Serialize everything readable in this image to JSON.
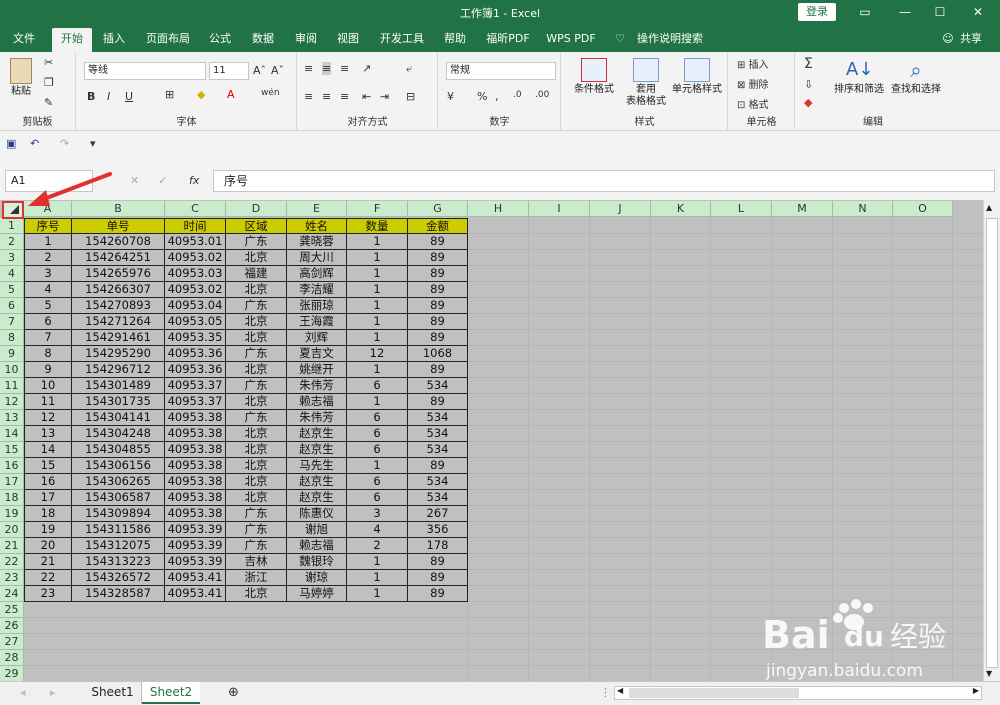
{
  "window": {
    "title": "工作簿1 - Excel",
    "login_label": "登录",
    "share_label": "共享"
  },
  "menu_tabs": [
    "文件",
    "开始",
    "插入",
    "页面布局",
    "公式",
    "数据",
    "审阅",
    "视图",
    "开发工具",
    "帮助",
    "福昕PDF",
    "WPS PDF",
    "操作说明搜索"
  ],
  "ribbon": {
    "clipboard": {
      "label": "剪贴板",
      "paste": "粘贴"
    },
    "font": {
      "label": "字体",
      "name": "等线",
      "size": "11",
      "grow": "Aˆ",
      "shrink": "Aˇ",
      "bold": "B",
      "italic": "I",
      "underline": "U",
      "wen": "wén"
    },
    "align": {
      "label": "对齐方式"
    },
    "number": {
      "label": "数字",
      "format": "常规"
    },
    "styles": {
      "label": "样式",
      "cond": "条件格式",
      "table1": "套用",
      "table2": "表格格式",
      "cell": "单元格样式"
    },
    "cells": {
      "label": "单元格",
      "insert": "插入",
      "delete": "删除",
      "format": "格式"
    },
    "edit": {
      "label": "编辑",
      "sort": "排序和筛选",
      "find": "查找和选择"
    }
  },
  "formula_bar": {
    "name_box": "A1",
    "fx": "fx",
    "value": "序号"
  },
  "columns": [
    "A",
    "B",
    "C",
    "D",
    "E",
    "F",
    "G",
    "H",
    "I",
    "J",
    "K",
    "L",
    "M",
    "N",
    "O"
  ],
  "rows": [
    "1",
    "2",
    "3",
    "4",
    "5",
    "6",
    "7",
    "8",
    "9",
    "10",
    "11",
    "12",
    "13",
    "14",
    "15",
    "16",
    "17",
    "18",
    "19",
    "20",
    "21",
    "22",
    "23",
    "24",
    "25",
    "26",
    "27",
    "28",
    "29"
  ],
  "table": {
    "headers": [
      "序号",
      "单号",
      "时间",
      "区域",
      "姓名",
      "数量",
      "金额"
    ],
    "rows": [
      [
        "1",
        "154260708",
        "40953.01",
        "广东",
        "龚晓蓉",
        "1",
        "89"
      ],
      [
        "2",
        "154264251",
        "40953.02",
        "北京",
        "周大川",
        "1",
        "89"
      ],
      [
        "3",
        "154265976",
        "40953.03",
        "福建",
        "高剑辉",
        "1",
        "89"
      ],
      [
        "4",
        "154266307",
        "40953.02",
        "北京",
        "李洁耀",
        "1",
        "89"
      ],
      [
        "5",
        "154270893",
        "40953.04",
        "广东",
        "张丽琼",
        "1",
        "89"
      ],
      [
        "6",
        "154271264",
        "40953.05",
        "北京",
        "王海霞",
        "1",
        "89"
      ],
      [
        "7",
        "154291461",
        "40953.35",
        "北京",
        "刘辉",
        "1",
        "89"
      ],
      [
        "8",
        "154295290",
        "40953.36",
        "广东",
        "夏吉文",
        "12",
        "1068"
      ],
      [
        "9",
        "154296712",
        "40953.36",
        "北京",
        "姚继开",
        "1",
        "89"
      ],
      [
        "10",
        "154301489",
        "40953.37",
        "广东",
        "朱伟芳",
        "6",
        "534"
      ],
      [
        "11",
        "154301735",
        "40953.37",
        "北京",
        "赖志福",
        "1",
        "89"
      ],
      [
        "12",
        "154304141",
        "40953.38",
        "广东",
        "朱伟芳",
        "6",
        "534"
      ],
      [
        "13",
        "154304248",
        "40953.38",
        "北京",
        "赵京生",
        "6",
        "534"
      ],
      [
        "14",
        "154304855",
        "40953.38",
        "北京",
        "赵京生",
        "6",
        "534"
      ],
      [
        "15",
        "154306156",
        "40953.38",
        "北京",
        "马先生",
        "1",
        "89"
      ],
      [
        "16",
        "154306265",
        "40953.38",
        "北京",
        "赵京生",
        "6",
        "534"
      ],
      [
        "17",
        "154306587",
        "40953.38",
        "北京",
        "赵京生",
        "6",
        "534"
      ],
      [
        "18",
        "154309894",
        "40953.38",
        "广东",
        "陈惠仪",
        "3",
        "267"
      ],
      [
        "19",
        "154311586",
        "40953.39",
        "广东",
        "谢旭",
        "4",
        "356"
      ],
      [
        "20",
        "154312075",
        "40953.39",
        "广东",
        "赖志福",
        "2",
        "178"
      ],
      [
        "21",
        "154313223",
        "40953.39",
        "吉林",
        "魏银玲",
        "1",
        "89"
      ],
      [
        "22",
        "154326572",
        "40953.41",
        "浙江",
        "谢琼",
        "1",
        "89"
      ],
      [
        "23",
        "154328587",
        "40953.41",
        "北京",
        "马婷婷",
        "1",
        "89"
      ]
    ]
  },
  "sheet_tabs": [
    "Sheet1",
    "Sheet2"
  ],
  "active_sheet": "Sheet2",
  "watermark": {
    "brand": "Bai",
    "brand2": "经验",
    "url": "jingyan.baidu.com"
  },
  "colors": {
    "excel_green": "#217346",
    "header_fill": "#cccc00",
    "selection_gray": "#c0c0c0",
    "annotation_red": "#e03030"
  }
}
